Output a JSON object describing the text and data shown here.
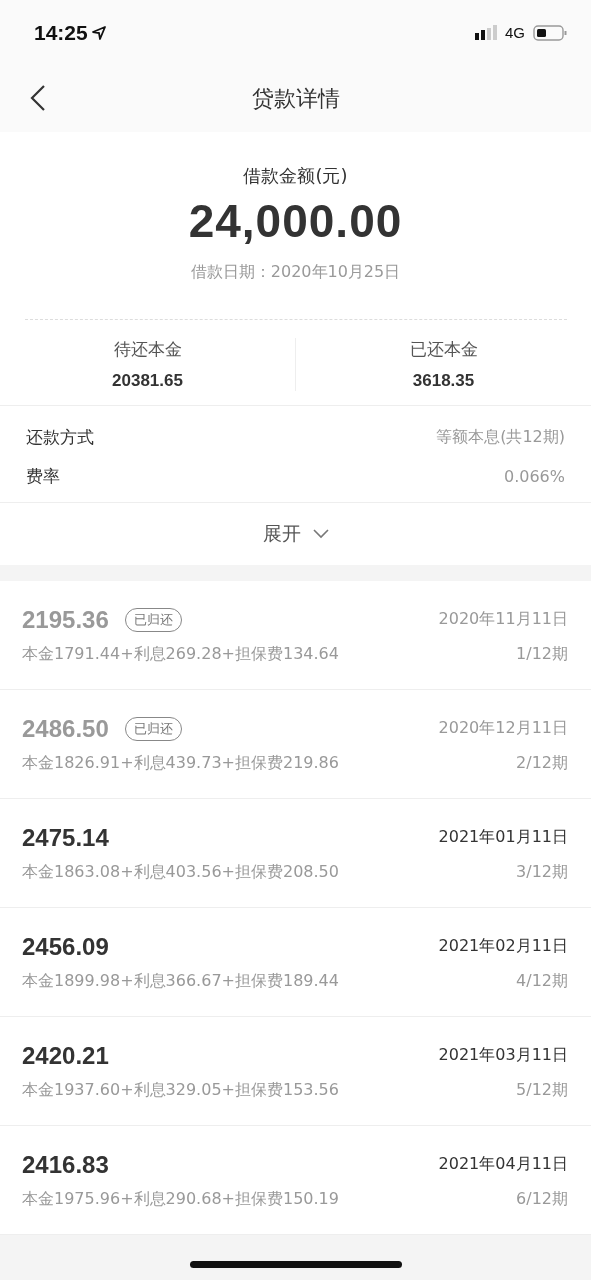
{
  "status_bar": {
    "time": "14:25",
    "network": "4G"
  },
  "nav": {
    "title": "贷款详情"
  },
  "summary": {
    "amount_label": "借款金额(元)",
    "amount": "24,000.00",
    "date": "借款日期：2020年10月25日",
    "stats": [
      {
        "label": "待还本金",
        "value": "20381.65"
      },
      {
        "label": "已还本金",
        "value": "3618.35"
      }
    ]
  },
  "details": [
    {
      "label": "还款方式",
      "value": "等额本息(共12期)"
    },
    {
      "label": "费率",
      "value": "0.066%"
    }
  ],
  "expand": {
    "label": "展开"
  },
  "installments": [
    {
      "amount": "2195.36",
      "repaid": true,
      "badge": "已归还",
      "date": "2020年11月11日",
      "breakdown": "本金1791.44+利息269.28+担保费134.64",
      "period": "1/12期"
    },
    {
      "amount": "2486.50",
      "repaid": true,
      "badge": "已归还",
      "date": "2020年12月11日",
      "breakdown": "本金1826.91+利息439.73+担保费219.86",
      "period": "2/12期"
    },
    {
      "amount": "2475.14",
      "repaid": false,
      "date": "2021年01月11日",
      "breakdown": "本金1863.08+利息403.56+担保费208.50",
      "period": "3/12期"
    },
    {
      "amount": "2456.09",
      "repaid": false,
      "date": "2021年02月11日",
      "breakdown": "本金1899.98+利息366.67+担保费189.44",
      "period": "4/12期"
    },
    {
      "amount": "2420.21",
      "repaid": false,
      "date": "2021年03月11日",
      "breakdown": "本金1937.60+利息329.05+担保费153.56",
      "period": "5/12期"
    },
    {
      "amount": "2416.83",
      "repaid": false,
      "date": "2021年04月11日",
      "breakdown": "本金1975.96+利息290.68+担保费150.19",
      "period": "6/12期"
    }
  ]
}
